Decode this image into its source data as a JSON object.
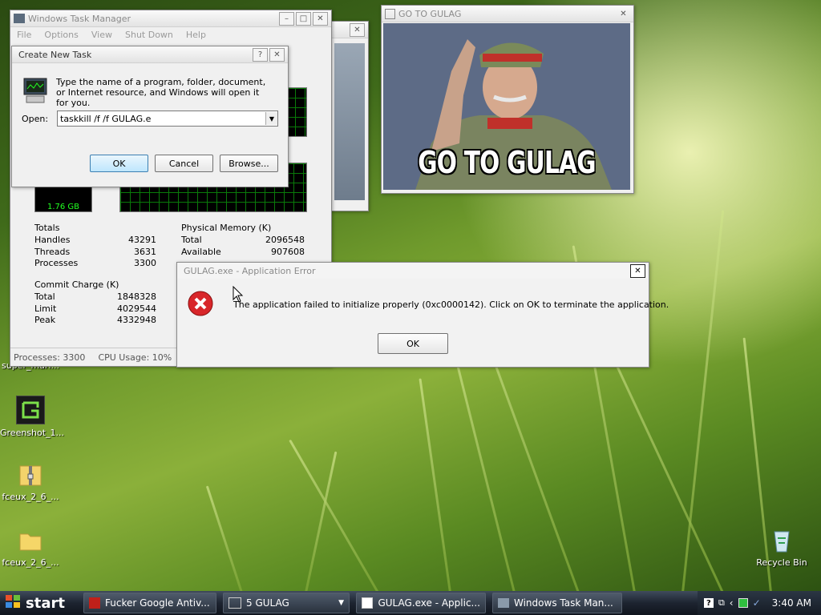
{
  "colors": {
    "error_red": "#d8262a",
    "taskbar": "#1d2430",
    "graph_green": "#21ff21"
  },
  "desktop_icons": {
    "partial_top": "super_mari...",
    "greenshot": "Greenshot_1...",
    "fceux1": "fceux_2_6_...",
    "fceux2": "fceux_2_6_...",
    "recycle": "Recycle Bin"
  },
  "task_manager": {
    "title": "Windows Task Manager",
    "menu": [
      "File",
      "Options",
      "View",
      "Shut Down",
      "Help"
    ],
    "pf_usage": "1.76 GB",
    "totals": {
      "heading": "Totals",
      "rows": [
        [
          "Handles",
          "43291"
        ],
        [
          "Threads",
          "3631"
        ],
        [
          "Processes",
          "3300"
        ]
      ]
    },
    "commit": {
      "heading": "Commit Charge (K)",
      "rows": [
        [
          "Total",
          "1848328"
        ],
        [
          "Limit",
          "4029544"
        ],
        [
          "Peak",
          "4332948"
        ]
      ]
    },
    "physical": {
      "heading": "Physical Memory (K)",
      "rows": [
        [
          "Total",
          "2096548"
        ],
        [
          "Available",
          "907608"
        ]
      ]
    },
    "status_processes": "Processes: 3300",
    "status_cpu": "CPU Usage: 10%"
  },
  "create_task": {
    "title": "Create New Task",
    "help_glyph": "?",
    "description": "Type the name of a program, folder, document, or Internet resource, and Windows will open it for you.",
    "open_label": "Open:",
    "open_value": "taskkill /f /f GULAG.e",
    "ok": "OK",
    "cancel": "Cancel",
    "browse": "Browse..."
  },
  "gulag_window": {
    "title": "GO TO GULAG",
    "caption": "GO TO GULAG"
  },
  "error_dialog": {
    "title": "GULAG.exe - Application Error",
    "message": "The application failed to initialize properly (0xc0000142). Click on OK to terminate the application.",
    "ok": "OK"
  },
  "taskbar": {
    "start": "start",
    "items": [
      "Fucker Google Antiv...",
      "5 GULAG",
      "GULAG.exe - Applic...",
      "Windows Task Man..."
    ],
    "clock": "3:40 AM"
  }
}
